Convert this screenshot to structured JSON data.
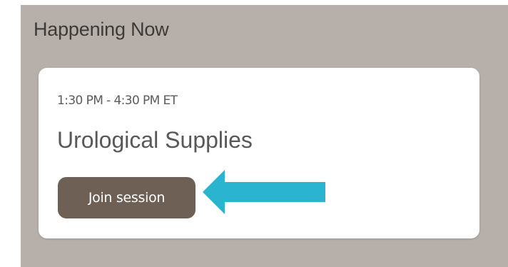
{
  "section": {
    "title": "Happening Now"
  },
  "session": {
    "time": "1:30 PM - 4:30 PM ET",
    "title": "Urological Supplies",
    "join_label": "Join session"
  },
  "colors": {
    "panel_background": "#b7b0aa",
    "button_background": "#6e6055",
    "arrow": "#2ab4d0"
  },
  "annotation": {
    "icon": "arrow-left-icon"
  }
}
